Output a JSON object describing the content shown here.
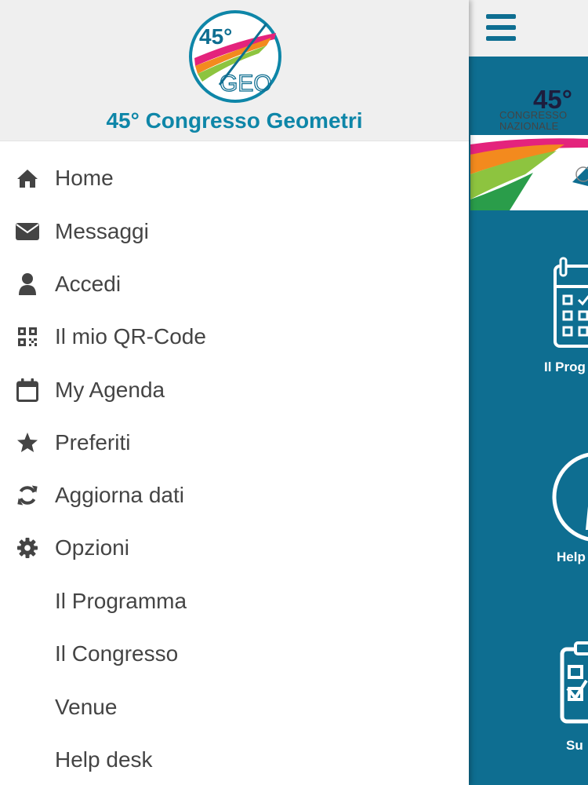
{
  "drawer": {
    "title": "45° Congresso Geometri",
    "logo": {
      "number": "45°",
      "text": "GEO"
    },
    "items": [
      {
        "label": "Home",
        "icon": "home-icon"
      },
      {
        "label": "Messaggi",
        "icon": "envelope-icon"
      },
      {
        "label": "Accedi",
        "icon": "user-icon"
      },
      {
        "label": "Il mio QR-Code",
        "icon": "qrcode-icon"
      },
      {
        "label": "My Agenda",
        "icon": "calendar-icon"
      },
      {
        "label": "Preferiti",
        "icon": "star-icon"
      },
      {
        "label": "Aggiorna dati",
        "icon": "refresh-icon"
      },
      {
        "label": "Opzioni",
        "icon": "gear-icon"
      },
      {
        "label": "Il Programma",
        "icon": ""
      },
      {
        "label": "Il Congresso",
        "icon": ""
      },
      {
        "label": "Venue",
        "icon": ""
      },
      {
        "label": "Help desk",
        "icon": ""
      }
    ]
  },
  "app": {
    "banner": {
      "number": "45°",
      "line1": "CONGRESSO",
      "line2": "NAZIONALE"
    },
    "tiles": [
      {
        "label": "Il Prog",
        "icon": "calendar-check-icon"
      },
      {
        "label": "Help",
        "icon": "info-icon"
      },
      {
        "label": "Su",
        "icon": "survey-clipboard-icon"
      }
    ]
  },
  "colors": {
    "brand": "#0e6e91",
    "title": "#0e86a8",
    "text": "#444444",
    "header_bg": "#efefef"
  }
}
